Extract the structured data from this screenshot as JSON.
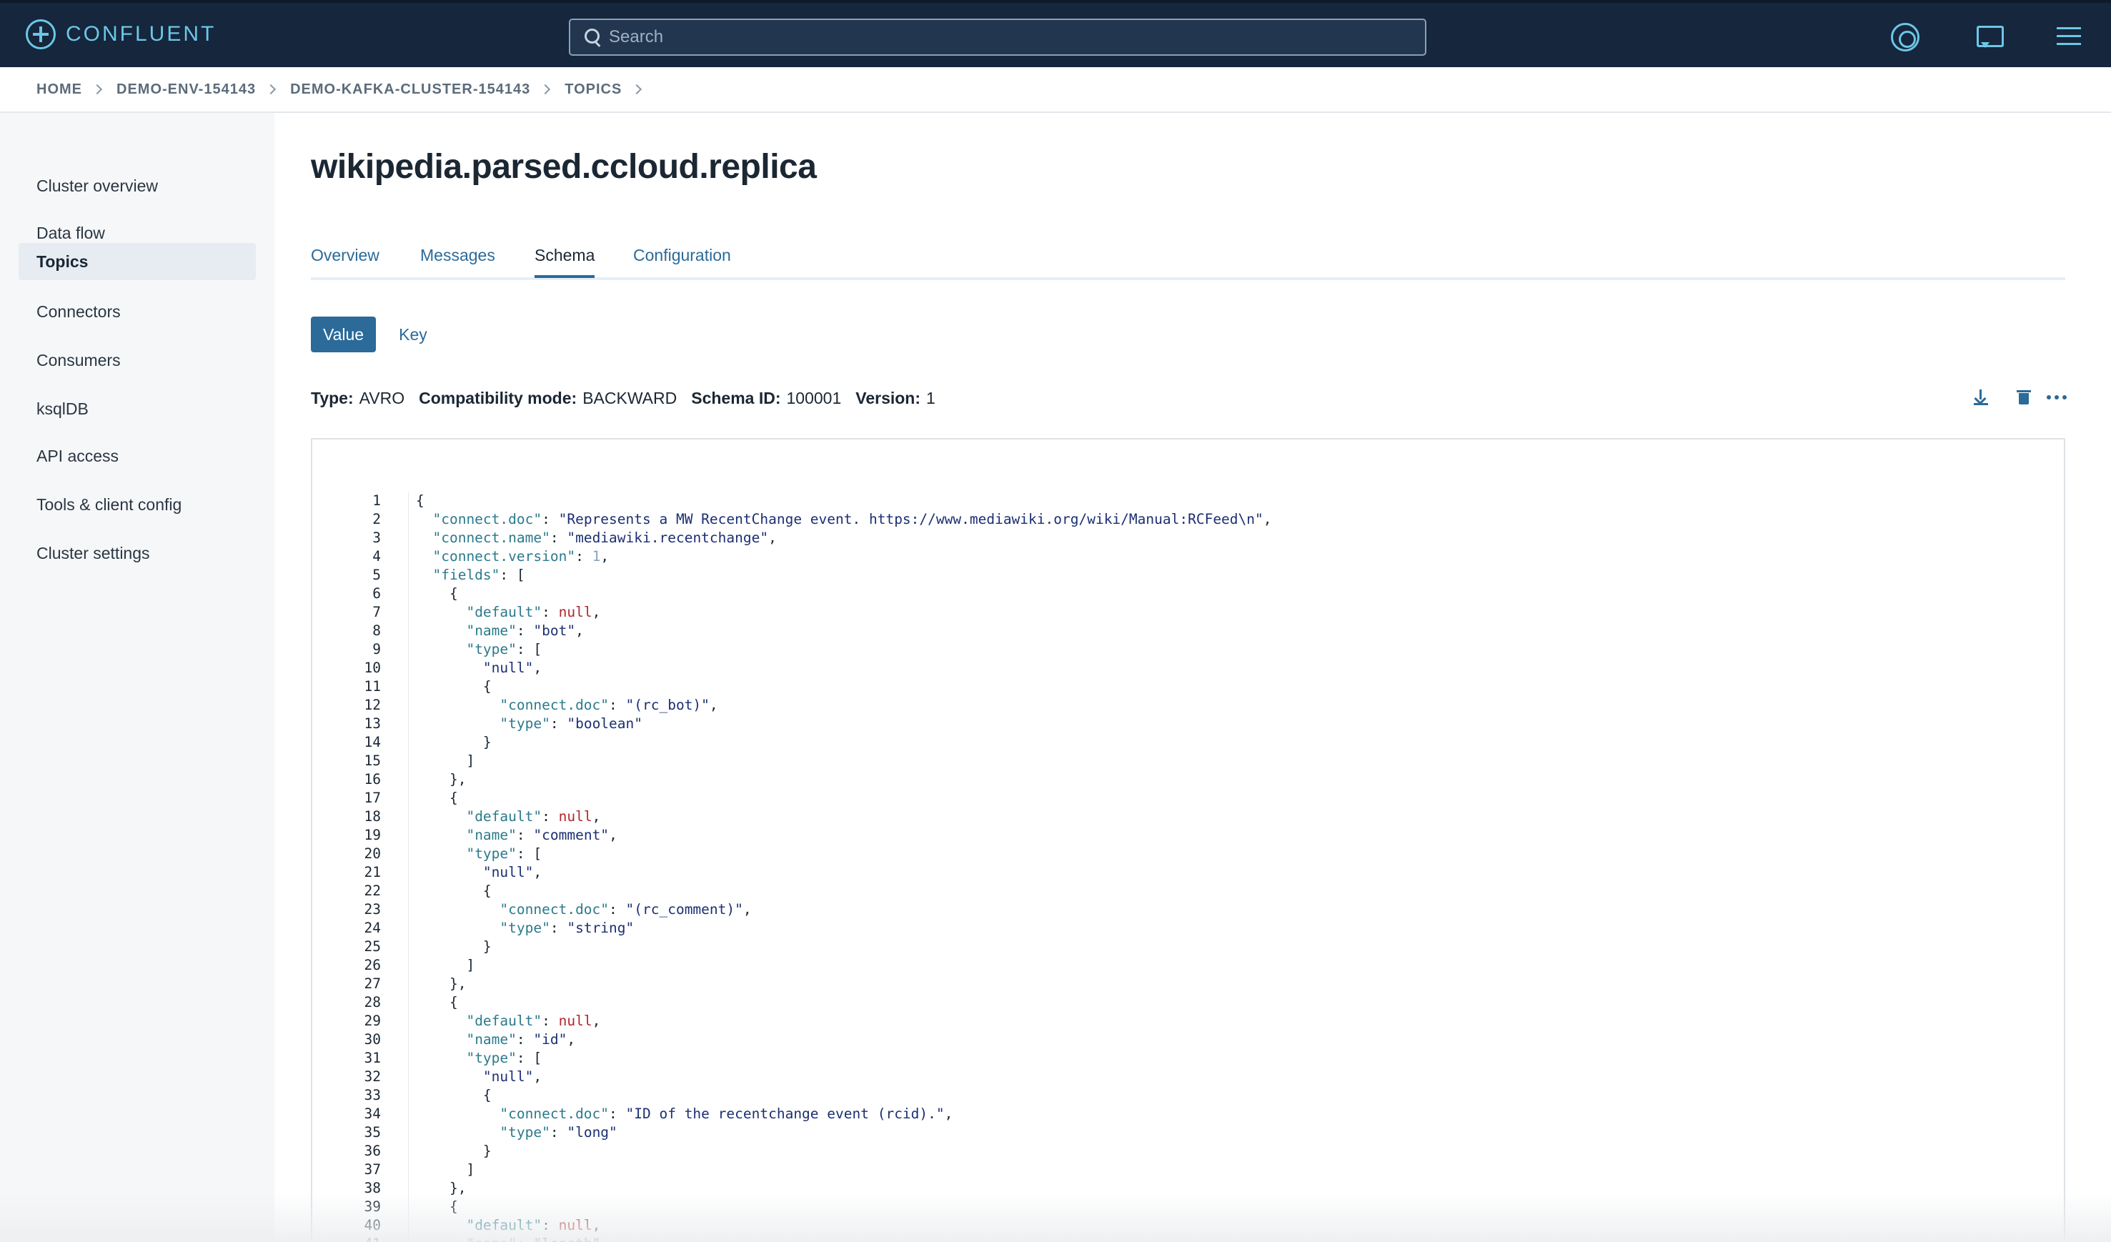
{
  "brand": {
    "name": "CONFLUENT"
  },
  "search": {
    "placeholder": "Search"
  },
  "header_icons": [
    "support-icon",
    "chat-icon",
    "menu-icon"
  ],
  "breadcrumb": [
    "HOME",
    "DEMO-ENV-154143",
    "DEMO-KAFKA-CLUSTER-154143",
    "TOPICS"
  ],
  "sidebar": {
    "items": [
      {
        "label": "Cluster overview",
        "active": false
      },
      {
        "label": "Data flow",
        "active": false
      },
      {
        "label": "Topics",
        "active": true
      },
      {
        "label": "Connectors",
        "active": false
      },
      {
        "label": "Consumers",
        "active": false
      },
      {
        "label": "ksqlDB",
        "active": false
      },
      {
        "label": "API access",
        "active": false
      },
      {
        "label": "Tools & client config",
        "active": false
      },
      {
        "label": "Cluster settings",
        "active": false
      }
    ]
  },
  "page_title": "wikipedia.parsed.ccloud.replica",
  "tabs": [
    {
      "label": "Overview",
      "active": false
    },
    {
      "label": "Messages",
      "active": false
    },
    {
      "label": "Schema",
      "active": true
    },
    {
      "label": "Configuration",
      "active": false
    }
  ],
  "schema_toggle": {
    "value_label": "Value",
    "key_label": "Key",
    "selected": "Value"
  },
  "schema_meta": {
    "type_label": "Type:",
    "type_value": "AVRO",
    "compat_label": "Compatibility mode:",
    "compat_value": "BACKWARD",
    "id_label": "Schema ID:",
    "id_value": "100001",
    "version_label": "Version:",
    "version_value": "1"
  },
  "actions": [
    "download-icon",
    "delete-icon",
    "more-icon"
  ],
  "colors": {
    "topbar": "#15263d",
    "accent": "#2b6a99",
    "brand": "#6cc7e6",
    "json_key": "#2b7a8c",
    "json_string": "#1c2f72",
    "json_null": "#b3262b"
  },
  "code_lines": [
    [
      [
        "p",
        "{"
      ]
    ],
    [
      [
        "p",
        "  "
      ],
      [
        "k",
        "\"connect.doc\""
      ],
      [
        "p",
        ": "
      ],
      [
        "s",
        "\"Represents a MW RecentChange event. https://www.mediawiki.org/wiki/Manual:RCFeed\\n\""
      ],
      [
        "p",
        ","
      ]
    ],
    [
      [
        "p",
        "  "
      ],
      [
        "k",
        "\"connect.name\""
      ],
      [
        "p",
        ": "
      ],
      [
        "s",
        "\"mediawiki.recentchange\""
      ],
      [
        "p",
        ","
      ]
    ],
    [
      [
        "p",
        "  "
      ],
      [
        "k",
        "\"connect.version\""
      ],
      [
        "p",
        ": "
      ],
      [
        "n",
        "1"
      ],
      [
        "p",
        ","
      ]
    ],
    [
      [
        "p",
        "  "
      ],
      [
        "k",
        "\"fields\""
      ],
      [
        "p",
        ": ["
      ]
    ],
    [
      [
        "p",
        "    {"
      ]
    ],
    [
      [
        "p",
        "      "
      ],
      [
        "k",
        "\"default\""
      ],
      [
        "p",
        ": "
      ],
      [
        "x",
        "null"
      ],
      [
        "p",
        ","
      ]
    ],
    [
      [
        "p",
        "      "
      ],
      [
        "k",
        "\"name\""
      ],
      [
        "p",
        ": "
      ],
      [
        "s",
        "\"bot\""
      ],
      [
        "p",
        ","
      ]
    ],
    [
      [
        "p",
        "      "
      ],
      [
        "k",
        "\"type\""
      ],
      [
        "p",
        ": ["
      ]
    ],
    [
      [
        "p",
        "        "
      ],
      [
        "s",
        "\"null\""
      ],
      [
        "p",
        ","
      ]
    ],
    [
      [
        "p",
        "        {"
      ]
    ],
    [
      [
        "p",
        "          "
      ],
      [
        "k",
        "\"connect.doc\""
      ],
      [
        "p",
        ": "
      ],
      [
        "s",
        "\"(rc_bot)\""
      ],
      [
        "p",
        ","
      ]
    ],
    [
      [
        "p",
        "          "
      ],
      [
        "k",
        "\"type\""
      ],
      [
        "p",
        ": "
      ],
      [
        "s",
        "\"boolean\""
      ]
    ],
    [
      [
        "p",
        "        }"
      ]
    ],
    [
      [
        "p",
        "      ]"
      ]
    ],
    [
      [
        "p",
        "    },"
      ]
    ],
    [
      [
        "p",
        "    {"
      ]
    ],
    [
      [
        "p",
        "      "
      ],
      [
        "k",
        "\"default\""
      ],
      [
        "p",
        ": "
      ],
      [
        "x",
        "null"
      ],
      [
        "p",
        ","
      ]
    ],
    [
      [
        "p",
        "      "
      ],
      [
        "k",
        "\"name\""
      ],
      [
        "p",
        ": "
      ],
      [
        "s",
        "\"comment\""
      ],
      [
        "p",
        ","
      ]
    ],
    [
      [
        "p",
        "      "
      ],
      [
        "k",
        "\"type\""
      ],
      [
        "p",
        ": ["
      ]
    ],
    [
      [
        "p",
        "        "
      ],
      [
        "s",
        "\"null\""
      ],
      [
        "p",
        ","
      ]
    ],
    [
      [
        "p",
        "        {"
      ]
    ],
    [
      [
        "p",
        "          "
      ],
      [
        "k",
        "\"connect.doc\""
      ],
      [
        "p",
        ": "
      ],
      [
        "s",
        "\"(rc_comment)\""
      ],
      [
        "p",
        ","
      ]
    ],
    [
      [
        "p",
        "          "
      ],
      [
        "k",
        "\"type\""
      ],
      [
        "p",
        ": "
      ],
      [
        "s",
        "\"string\""
      ]
    ],
    [
      [
        "p",
        "        }"
      ]
    ],
    [
      [
        "p",
        "      ]"
      ]
    ],
    [
      [
        "p",
        "    },"
      ]
    ],
    [
      [
        "p",
        "    {"
      ]
    ],
    [
      [
        "p",
        "      "
      ],
      [
        "k",
        "\"default\""
      ],
      [
        "p",
        ": "
      ],
      [
        "x",
        "null"
      ],
      [
        "p",
        ","
      ]
    ],
    [
      [
        "p",
        "      "
      ],
      [
        "k",
        "\"name\""
      ],
      [
        "p",
        ": "
      ],
      [
        "s",
        "\"id\""
      ],
      [
        "p",
        ","
      ]
    ],
    [
      [
        "p",
        "      "
      ],
      [
        "k",
        "\"type\""
      ],
      [
        "p",
        ": ["
      ]
    ],
    [
      [
        "p",
        "        "
      ],
      [
        "s",
        "\"null\""
      ],
      [
        "p",
        ","
      ]
    ],
    [
      [
        "p",
        "        {"
      ]
    ],
    [
      [
        "p",
        "          "
      ],
      [
        "k",
        "\"connect.doc\""
      ],
      [
        "p",
        ": "
      ],
      [
        "s",
        "\"ID of the recentchange event (rcid).\""
      ],
      [
        "p",
        ","
      ]
    ],
    [
      [
        "p",
        "          "
      ],
      [
        "k",
        "\"type\""
      ],
      [
        "p",
        ": "
      ],
      [
        "s",
        "\"long\""
      ]
    ],
    [
      [
        "p",
        "        }"
      ]
    ],
    [
      [
        "p",
        "      ]"
      ]
    ],
    [
      [
        "p",
        "    },"
      ]
    ],
    [
      [
        "p",
        "    {"
      ]
    ],
    [
      [
        "p",
        "      "
      ],
      [
        "k",
        "\"default\""
      ],
      [
        "p",
        ": "
      ],
      [
        "x",
        "null"
      ],
      [
        "p",
        ","
      ]
    ],
    [
      [
        "p",
        "      "
      ],
      [
        "k",
        "\"name\""
      ],
      [
        "p",
        ": "
      ],
      [
        "s",
        "\"length\""
      ],
      [
        "p",
        ","
      ]
    ]
  ]
}
